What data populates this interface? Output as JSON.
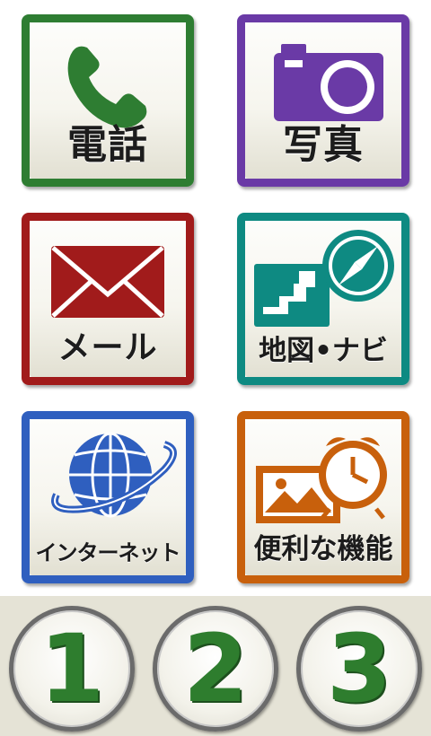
{
  "tiles": [
    {
      "label": "電話",
      "icon": "phone-icon",
      "color": "#2e7d32"
    },
    {
      "label": "写真",
      "icon": "camera-icon",
      "color": "#6a3aa6"
    },
    {
      "label": "メール",
      "icon": "mail-icon",
      "color": "#b71c1c"
    },
    {
      "label": "地図•ナビ",
      "icon": "map-compass-icon",
      "color": "#0e8a82"
    },
    {
      "label": "インターネット",
      "icon": "globe-icon",
      "color": "#2f5fbf"
    },
    {
      "label": "便利な機能",
      "icon": "picture-alarm-clock-icon",
      "color": "#c8600c"
    }
  ],
  "numbers": [
    "1",
    "2",
    "3"
  ],
  "colors": {
    "number_text": "#2e7d2e",
    "bottom_bar": "#e5e3d6"
  }
}
